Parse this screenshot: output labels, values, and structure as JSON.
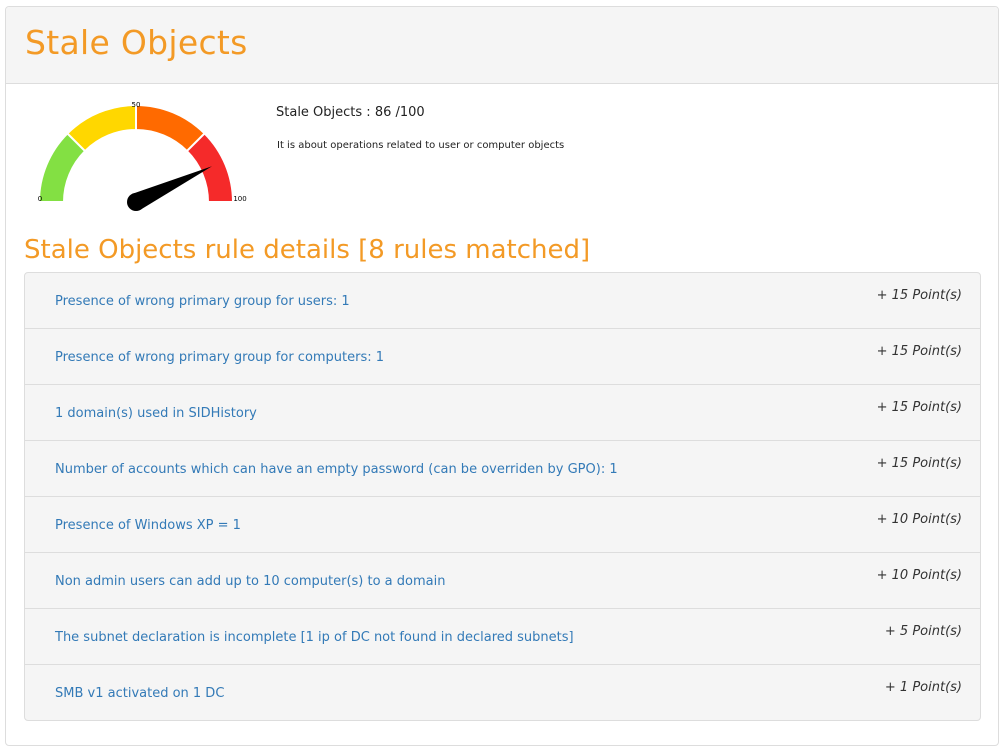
{
  "header": {
    "title": "Stale Objects"
  },
  "gauge": {
    "value": 86,
    "min_label": "0",
    "mid_label": "50",
    "max_label": "100",
    "colors": [
      "#83e043",
      "#ffd700",
      "#ff6a00",
      "#f52a2a"
    ],
    "needle_color": "#000000"
  },
  "score": {
    "text": "Stale Objects : 86 /100",
    "description": "It is about operations related to user or computer objects"
  },
  "rules": {
    "title": "Stale Objects rule details [8 rules matched]",
    "items": [
      {
        "label": "Presence of wrong primary group for users: 1",
        "points": "+ 15 Point(s)"
      },
      {
        "label": "Presence of wrong primary group for computers: 1",
        "points": "+ 15 Point(s)"
      },
      {
        "label": "1 domain(s) used in SIDHistory",
        "points": "+ 15 Point(s)"
      },
      {
        "label": "Number of accounts which can have an empty password (can be overriden by GPO): 1",
        "points": "+ 15 Point(s)"
      },
      {
        "label": "Presence of Windows XP = 1",
        "points": "+ 10 Point(s)"
      },
      {
        "label": "Non admin users can add up to 10 computer(s) to a domain",
        "points": "+ 10 Point(s)"
      },
      {
        "label": "The subnet declaration is incomplete [1 ip of DC not found in declared subnets]",
        "points": "+ 5 Point(s)"
      },
      {
        "label": "SMB v1 activated on 1 DC",
        "points": "+ 1 Point(s)"
      }
    ]
  }
}
